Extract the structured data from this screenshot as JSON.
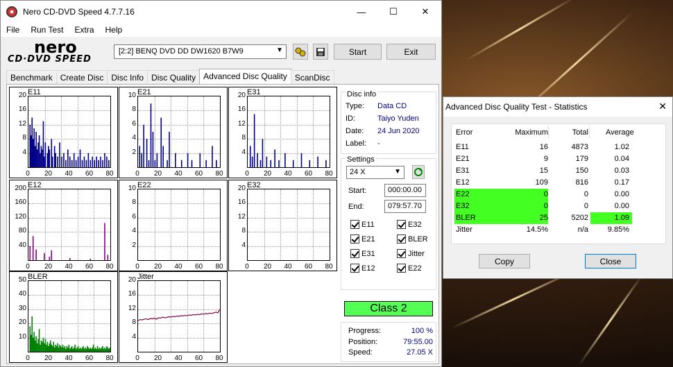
{
  "app": {
    "title": "Nero CD-DVD Speed 4.7.7.16",
    "menu": [
      "File",
      "Run Test",
      "Extra",
      "Help"
    ],
    "logo_top": "nero",
    "logo_bottom": "CD·DVD SPEED",
    "drive": "[2:2]   BENQ DVD DD DW1620 B7W9",
    "start_label": "Start",
    "exit_label": "Exit",
    "tabs": [
      "Benchmark",
      "Create Disc",
      "Disc Info",
      "Disc Quality",
      "Advanced Disc Quality",
      "ScanDisc"
    ],
    "active_tab": 4
  },
  "disc_info": {
    "legend": "Disc info",
    "type_label": "Type:",
    "type": "Data CD",
    "id_label": "ID:",
    "id": "Taiyo Yuden",
    "date_label": "Date:",
    "date": "24 Jun 2020",
    "label_label": "Label:",
    "label": "-"
  },
  "settings": {
    "legend": "Settings",
    "speed": "24 X",
    "start_label": "Start:",
    "start": "000:00.00",
    "end_label": "End:",
    "end": "079:57.70",
    "checks": [
      "E11",
      "E32",
      "E21",
      "BLER",
      "E31",
      "Jitter",
      "E12",
      "E22"
    ]
  },
  "result": {
    "class": "Class 2",
    "progress_label": "Progress:",
    "progress": "100 %",
    "position_label": "Position:",
    "position": "79:55.00",
    "speed_label": "Speed:",
    "speed": "27.05 X"
  },
  "colors": {
    "bar": "#00008b",
    "bler": "#008000",
    "jitter": "#800040",
    "class_bg": "#54ff54",
    "highlight": "#44ff22"
  },
  "chart_data": [
    {
      "type": "bar",
      "title": "E11",
      "yticks": [
        "20",
        "16",
        "12",
        "8",
        "4"
      ],
      "xticks": [
        "0",
        "20",
        "40",
        "60",
        "80"
      ],
      "ylim": [
        0,
        20
      ],
      "xlim": [
        0,
        80
      ],
      "color": "#00008b",
      "values": [
        [
          1,
          12
        ],
        [
          2,
          9
        ],
        [
          3,
          14
        ],
        [
          4,
          8
        ],
        [
          5,
          11
        ],
        [
          6,
          6
        ],
        [
          7,
          10
        ],
        [
          8,
          5
        ],
        [
          9,
          7
        ],
        [
          10,
          9
        ],
        [
          11,
          4
        ],
        [
          12,
          6
        ],
        [
          13,
          5
        ],
        [
          14,
          13
        ],
        [
          15,
          3
        ],
        [
          16,
          7
        ],
        [
          18,
          4
        ],
        [
          19,
          6
        ],
        [
          20,
          5
        ],
        [
          22,
          8
        ],
        [
          23,
          3
        ],
        [
          25,
          6
        ],
        [
          26,
          4
        ],
        [
          28,
          3
        ],
        [
          30,
          7
        ],
        [
          32,
          3
        ],
        [
          34,
          4
        ],
        [
          36,
          2
        ],
        [
          38,
          5
        ],
        [
          40,
          3
        ],
        [
          42,
          2
        ],
        [
          44,
          4
        ],
        [
          46,
          2
        ],
        [
          48,
          3
        ],
        [
          50,
          5
        ],
        [
          52,
          2
        ],
        [
          54,
          3
        ],
        [
          56,
          2
        ],
        [
          58,
          4
        ],
        [
          60,
          2
        ],
        [
          62,
          3
        ],
        [
          64,
          2
        ],
        [
          66,
          3
        ],
        [
          68,
          2
        ],
        [
          70,
          3
        ],
        [
          72,
          2
        ],
        [
          74,
          4
        ],
        [
          76,
          3
        ],
        [
          78,
          2
        ],
        [
          80,
          3
        ]
      ]
    },
    {
      "type": "bar",
      "title": "E21",
      "yticks": [
        "10",
        "8",
        "6",
        "4",
        "2"
      ],
      "xticks": [
        "0",
        "20",
        "40",
        "60",
        "80"
      ],
      "ylim": [
        0,
        10
      ],
      "xlim": [
        0,
        80
      ],
      "color": "#00008b",
      "values": [
        [
          1,
          3
        ],
        [
          3,
          2
        ],
        [
          5,
          6
        ],
        [
          8,
          4
        ],
        [
          10,
          1
        ],
        [
          12,
          9
        ],
        [
          14,
          5
        ],
        [
          16,
          1
        ],
        [
          18,
          2
        ],
        [
          22,
          7
        ],
        [
          24,
          3
        ],
        [
          28,
          1
        ],
        [
          30,
          5
        ],
        [
          36,
          2
        ],
        [
          42,
          1
        ],
        [
          48,
          2
        ],
        [
          52,
          1
        ],
        [
          60,
          2
        ],
        [
          66,
          1
        ],
        [
          72,
          3
        ],
        [
          76,
          1
        ]
      ]
    },
    {
      "type": "bar",
      "title": "E31",
      "yticks": [
        "20",
        "16",
        "12",
        "8",
        "4"
      ],
      "xticks": [
        "0",
        "20",
        "40",
        "60",
        "80"
      ],
      "ylim": [
        0,
        20
      ],
      "xlim": [
        0,
        80
      ],
      "color": "#00008b",
      "values": [
        [
          2,
          6
        ],
        [
          4,
          3
        ],
        [
          6,
          15
        ],
        [
          9,
          4
        ],
        [
          12,
          2
        ],
        [
          14,
          8
        ],
        [
          18,
          3
        ],
        [
          22,
          2
        ],
        [
          26,
          5
        ],
        [
          30,
          2
        ],
        [
          36,
          4
        ],
        [
          44,
          2
        ],
        [
          52,
          4
        ],
        [
          60,
          2
        ],
        [
          68,
          3
        ],
        [
          76,
          2
        ]
      ]
    },
    {
      "type": "bar",
      "title": "E12",
      "yticks": [
        "200",
        "160",
        "120",
        "80",
        "40"
      ],
      "xticks": [
        "0",
        "20",
        "40",
        "60",
        "80"
      ],
      "ylim": [
        0,
        200
      ],
      "xlim": [
        0,
        80
      ],
      "color": "#800080",
      "values": [
        [
          1,
          40
        ],
        [
          4,
          68
        ],
        [
          7,
          30
        ],
        [
          15,
          20
        ],
        [
          20,
          10
        ],
        [
          22,
          28
        ],
        [
          40,
          6
        ],
        [
          60,
          4
        ],
        [
          74,
          105
        ],
        [
          77,
          15
        ]
      ]
    },
    {
      "type": "bar",
      "title": "E22",
      "yticks": [
        "10",
        "8",
        "6",
        "4",
        "2"
      ],
      "xticks": [
        "0",
        "20",
        "40",
        "60",
        "80"
      ],
      "ylim": [
        0,
        10
      ],
      "xlim": [
        0,
        80
      ],
      "color": "#00008b",
      "values": []
    },
    {
      "type": "bar",
      "title": "E32",
      "yticks": [
        "20",
        "16",
        "12",
        "8",
        "4"
      ],
      "xticks": [
        "0",
        "20",
        "40",
        "60",
        "80"
      ],
      "ylim": [
        0,
        20
      ],
      "xlim": [
        0,
        80
      ],
      "color": "#00008b",
      "values": []
    },
    {
      "type": "bar",
      "title": "BLER",
      "yticks": [
        "50",
        "40",
        "30",
        "20",
        "10"
      ],
      "xticks": [
        "0",
        "20",
        "40",
        "60",
        "80"
      ],
      "ylim": [
        0,
        50
      ],
      "xlim": [
        0,
        80
      ],
      "color": "#008000",
      "values": [
        [
          1,
          18
        ],
        [
          2,
          12
        ],
        [
          3,
          25
        ],
        [
          4,
          10
        ],
        [
          5,
          14
        ],
        [
          6,
          8
        ],
        [
          7,
          11
        ],
        [
          8,
          6
        ],
        [
          9,
          9
        ],
        [
          10,
          16
        ],
        [
          11,
          5
        ],
        [
          12,
          8
        ],
        [
          13,
          7
        ],
        [
          14,
          10
        ],
        [
          15,
          6
        ],
        [
          16,
          9
        ],
        [
          17,
          5
        ],
        [
          18,
          7
        ],
        [
          19,
          4
        ],
        [
          20,
          6
        ],
        [
          21,
          8
        ],
        [
          22,
          5
        ],
        [
          23,
          4
        ],
        [
          24,
          7
        ],
        [
          25,
          3
        ],
        [
          26,
          5
        ],
        [
          27,
          4
        ],
        [
          28,
          6
        ],
        [
          29,
          3
        ],
        [
          30,
          5
        ],
        [
          31,
          4
        ],
        [
          32,
          3
        ],
        [
          33,
          5
        ],
        [
          34,
          3
        ],
        [
          35,
          4
        ],
        [
          36,
          2
        ],
        [
          37,
          4
        ],
        [
          38,
          3
        ],
        [
          39,
          5
        ],
        [
          40,
          2
        ],
        [
          41,
          3
        ],
        [
          42,
          4
        ],
        [
          43,
          2
        ],
        [
          44,
          3
        ],
        [
          45,
          5
        ],
        [
          46,
          2
        ],
        [
          47,
          3
        ],
        [
          48,
          4
        ],
        [
          49,
          2
        ],
        [
          50,
          3
        ],
        [
          51,
          2
        ],
        [
          52,
          3
        ],
        [
          53,
          4
        ],
        [
          54,
          2
        ],
        [
          55,
          3
        ],
        [
          56,
          2
        ],
        [
          57,
          4
        ],
        [
          58,
          3
        ],
        [
          59,
          2
        ],
        [
          60,
          3
        ],
        [
          61,
          2
        ],
        [
          62,
          3
        ],
        [
          63,
          5
        ],
        [
          64,
          2
        ],
        [
          65,
          3
        ],
        [
          66,
          2
        ],
        [
          67,
          4
        ],
        [
          68,
          2
        ],
        [
          69,
          3
        ],
        [
          70,
          2
        ],
        [
          71,
          3
        ],
        [
          72,
          4
        ],
        [
          73,
          2
        ],
        [
          74,
          3
        ],
        [
          75,
          2
        ],
        [
          76,
          4
        ],
        [
          77,
          3
        ],
        [
          78,
          2
        ],
        [
          79,
          3
        ]
      ]
    },
    {
      "type": "line",
      "title": "Jitter",
      "yticks": [
        "20",
        "16",
        "12",
        "8",
        "4"
      ],
      "xticks": [
        "0",
        "20",
        "40",
        "60",
        "80"
      ],
      "ylim": [
        0,
        20
      ],
      "xlim": [
        0,
        80
      ],
      "color": "#800040",
      "x": [
        0,
        2,
        4,
        6,
        8,
        10,
        12,
        14,
        16,
        18,
        20,
        22,
        24,
        26,
        28,
        30,
        32,
        34,
        36,
        38,
        40,
        42,
        44,
        46,
        48,
        50,
        52,
        54,
        56,
        58,
        60,
        62,
        64,
        66,
        68,
        70,
        72,
        74,
        76,
        78,
        80
      ],
      "y": [
        8.8,
        9.1,
        9.0,
        9.2,
        9.3,
        9.1,
        9.4,
        9.3,
        9.5,
        9.2,
        9.6,
        9.5,
        9.8,
        9.6,
        9.7,
        9.9,
        9.8,
        10.0,
        9.9,
        10.1,
        10.0,
        10.2,
        10.1,
        10.3,
        10.2,
        10.4,
        10.3,
        10.5,
        10.4,
        10.6,
        10.5,
        10.7,
        10.6,
        10.8,
        10.7,
        10.9,
        10.8,
        11.0,
        11.2,
        11.0,
        12.0
      ]
    }
  ],
  "stats": {
    "title": "Advanced Disc Quality Test - Statistics",
    "headers": [
      "Error",
      "Maximum",
      "Total",
      "Average"
    ],
    "rows": [
      {
        "name": "E11",
        "max": "16",
        "total": "4873",
        "avg": "1.02",
        "hl_name": false,
        "hl_avg": false
      },
      {
        "name": "E21",
        "max": "9",
        "total": "179",
        "avg": "0.04",
        "hl_name": false,
        "hl_avg": false
      },
      {
        "name": "E31",
        "max": "15",
        "total": "150",
        "avg": "0.03",
        "hl_name": false,
        "hl_avg": false
      },
      {
        "name": "E12",
        "max": "109",
        "total": "816",
        "avg": "0.17",
        "hl_name": false,
        "hl_avg": false
      },
      {
        "name": "E22",
        "max": "0",
        "total": "0",
        "avg": "0.00",
        "hl_name": true,
        "hl_avg": false
      },
      {
        "name": "E32",
        "max": "0",
        "total": "0",
        "avg": "0.00",
        "hl_name": true,
        "hl_avg": false
      },
      {
        "name": "BLER",
        "max": "25",
        "total": "5202",
        "avg": "1.09",
        "hl_name": true,
        "hl_avg": true
      },
      {
        "name": "Jitter",
        "max": "14.5%",
        "total": "n/a",
        "avg": "9.85%",
        "hl_name": false,
        "hl_avg": false
      }
    ],
    "copy_label": "Copy",
    "close_label": "Close"
  }
}
